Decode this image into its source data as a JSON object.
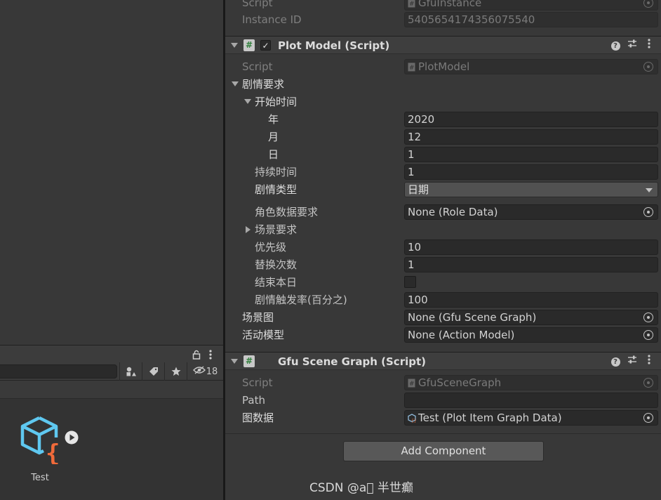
{
  "project": {
    "filter_count": "18",
    "asset": {
      "name": "Test"
    }
  },
  "inspector": {
    "top_rows": [
      {
        "label": "Script",
        "value": "GfuInstance"
      },
      {
        "label": "Instance ID",
        "value": "5405654174356075540"
      }
    ],
    "plot_model": {
      "title": "Plot Model (Script)",
      "enabled_check": "✓",
      "script_label": "Script",
      "script_value": "PlotModel",
      "section_label": "剧情要求",
      "start_time_label": "开始时间",
      "year_label": "年",
      "year_value": "2020",
      "month_label": "月",
      "month_value": "12",
      "day_label": "日",
      "day_value": "1",
      "duration_label": "持续时间",
      "duration_value": "1",
      "plot_type_label": "剧情类型",
      "plot_type_value": "日期",
      "role_data_label": "角色数据要求",
      "role_data_value": "None (Role Data)",
      "scene_req_label": "场景要求",
      "priority_label": "优先级",
      "priority_value": "10",
      "replace_count_label": "替换次数",
      "replace_count_value": "1",
      "end_today_label": "结束本日",
      "trigger_rate_label": "剧情触发率(百分之)",
      "trigger_rate_value": "100",
      "scene_graph_label": "场景图",
      "scene_graph_value": "None (Gfu Scene Graph)",
      "action_model_label": "活动模型",
      "action_model_value": "None (Action Model)"
    },
    "gfu_scene_graph": {
      "title": "Gfu Scene Graph (Script)",
      "script_label": "Script",
      "script_value": "GfuSceneGraph",
      "path_label": "Path",
      "path_value": "",
      "graph_data_label": "图数据",
      "graph_data_value": "Test (Plot Item Graph Data)"
    },
    "add_component_label": "Add Component"
  },
  "watermark": "CSDN @a\u0000 半世癫",
  "icons": [
    "lock-icon",
    "kebab-menu-icon",
    "filter-by-type-icon",
    "label-icon",
    "star-icon",
    "hidden-packages-icon",
    "script-hash-icon",
    "help-icon",
    "presets-icon",
    "object-picker-icon",
    "dropdown-arrow-icon",
    "fold-arrow-icon",
    "cube-script-asset-icon",
    "play-icon"
  ]
}
